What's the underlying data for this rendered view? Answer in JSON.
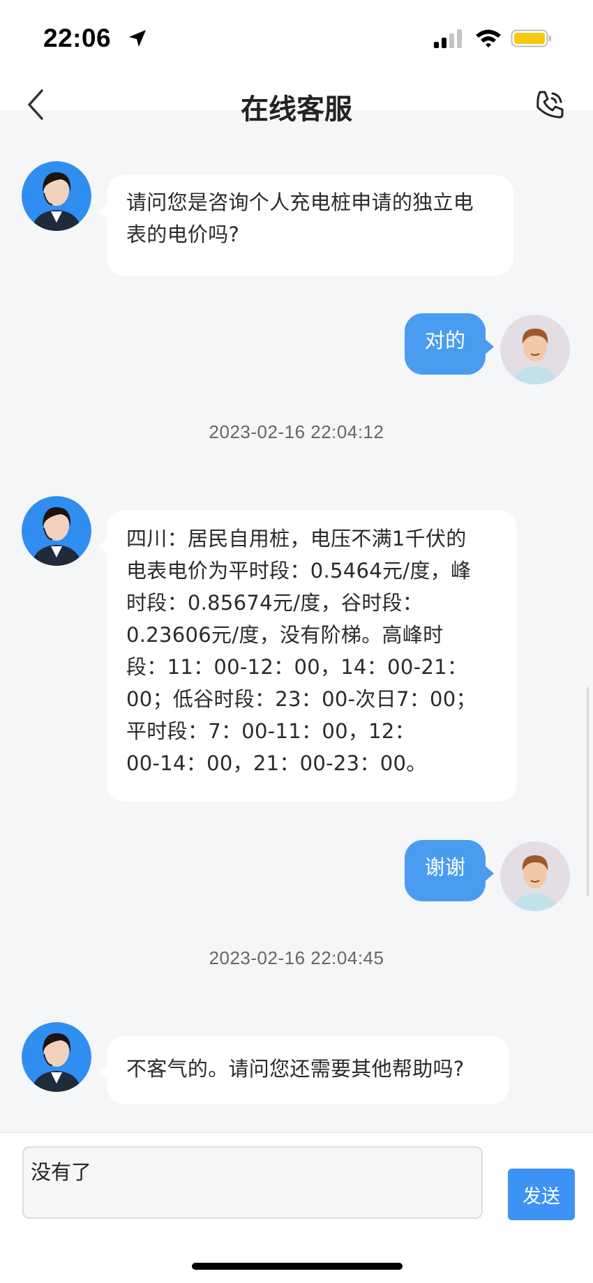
{
  "status_bar": {
    "time": "22:06"
  },
  "nav": {
    "title": "在线客服"
  },
  "messages": [
    {
      "from": "agent",
      "text_lines": [
        "请问您是咨询个人充电桩申请的独立电",
        "表的电价吗?"
      ]
    },
    {
      "from": "user",
      "text": "对的"
    },
    {
      "timestamp": "2023-02-16 22:04:12"
    },
    {
      "from": "agent",
      "text_lines": [
        "四川：居民自用桩，电压不满1千伏的",
        "电表电价为平时段：0.5464元/度，峰",
        "时段：0.85674元/度，谷时段：",
        "0.23606元/度，没有阶梯。高峰时",
        "段：11：00-12：00，14：00-21：",
        "00；低谷时段：23：00-次日7：00；",
        "平时段：7：00-11：00，12：",
        "00-14：00，21：00-23：00。"
      ]
    },
    {
      "from": "user",
      "text": "谢谢"
    },
    {
      "timestamp": "2023-02-16 22:04:45"
    },
    {
      "from": "agent",
      "text_lines": [
        "不客气的。请问您还需要其他帮助吗?"
      ]
    }
  ],
  "input": {
    "value": "没有了"
  },
  "send_label": "发送",
  "colors": {
    "accent": "#4a9cf1",
    "background": "#f5f6f8"
  },
  "icons": {
    "back": "chevron-left-icon",
    "call": "phone-call-icon",
    "location": "location-arrow-icon",
    "signal": "cellular-signal-icon",
    "wifi": "wifi-icon",
    "battery": "battery-icon"
  }
}
